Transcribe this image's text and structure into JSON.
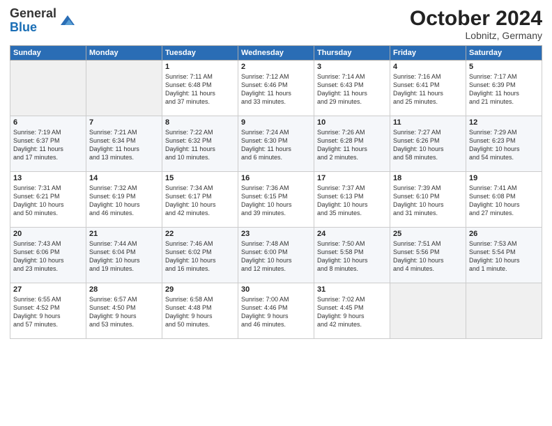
{
  "header": {
    "logo_general": "General",
    "logo_blue": "Blue",
    "month_title": "October 2024",
    "location": "Lobnitz, Germany"
  },
  "weekdays": [
    "Sunday",
    "Monday",
    "Tuesday",
    "Wednesday",
    "Thursday",
    "Friday",
    "Saturday"
  ],
  "weeks": [
    [
      {
        "day": "",
        "content": ""
      },
      {
        "day": "",
        "content": ""
      },
      {
        "day": "1",
        "content": "Sunrise: 7:11 AM\nSunset: 6:48 PM\nDaylight: 11 hours\nand 37 minutes."
      },
      {
        "day": "2",
        "content": "Sunrise: 7:12 AM\nSunset: 6:46 PM\nDaylight: 11 hours\nand 33 minutes."
      },
      {
        "day": "3",
        "content": "Sunrise: 7:14 AM\nSunset: 6:43 PM\nDaylight: 11 hours\nand 29 minutes."
      },
      {
        "day": "4",
        "content": "Sunrise: 7:16 AM\nSunset: 6:41 PM\nDaylight: 11 hours\nand 25 minutes."
      },
      {
        "day": "5",
        "content": "Sunrise: 7:17 AM\nSunset: 6:39 PM\nDaylight: 11 hours\nand 21 minutes."
      }
    ],
    [
      {
        "day": "6",
        "content": "Sunrise: 7:19 AM\nSunset: 6:37 PM\nDaylight: 11 hours\nand 17 minutes."
      },
      {
        "day": "7",
        "content": "Sunrise: 7:21 AM\nSunset: 6:34 PM\nDaylight: 11 hours\nand 13 minutes."
      },
      {
        "day": "8",
        "content": "Sunrise: 7:22 AM\nSunset: 6:32 PM\nDaylight: 11 hours\nand 10 minutes."
      },
      {
        "day": "9",
        "content": "Sunrise: 7:24 AM\nSunset: 6:30 PM\nDaylight: 11 hours\nand 6 minutes."
      },
      {
        "day": "10",
        "content": "Sunrise: 7:26 AM\nSunset: 6:28 PM\nDaylight: 11 hours\nand 2 minutes."
      },
      {
        "day": "11",
        "content": "Sunrise: 7:27 AM\nSunset: 6:26 PM\nDaylight: 10 hours\nand 58 minutes."
      },
      {
        "day": "12",
        "content": "Sunrise: 7:29 AM\nSunset: 6:23 PM\nDaylight: 10 hours\nand 54 minutes."
      }
    ],
    [
      {
        "day": "13",
        "content": "Sunrise: 7:31 AM\nSunset: 6:21 PM\nDaylight: 10 hours\nand 50 minutes."
      },
      {
        "day": "14",
        "content": "Sunrise: 7:32 AM\nSunset: 6:19 PM\nDaylight: 10 hours\nand 46 minutes."
      },
      {
        "day": "15",
        "content": "Sunrise: 7:34 AM\nSunset: 6:17 PM\nDaylight: 10 hours\nand 42 minutes."
      },
      {
        "day": "16",
        "content": "Sunrise: 7:36 AM\nSunset: 6:15 PM\nDaylight: 10 hours\nand 39 minutes."
      },
      {
        "day": "17",
        "content": "Sunrise: 7:37 AM\nSunset: 6:13 PM\nDaylight: 10 hours\nand 35 minutes."
      },
      {
        "day": "18",
        "content": "Sunrise: 7:39 AM\nSunset: 6:10 PM\nDaylight: 10 hours\nand 31 minutes."
      },
      {
        "day": "19",
        "content": "Sunrise: 7:41 AM\nSunset: 6:08 PM\nDaylight: 10 hours\nand 27 minutes."
      }
    ],
    [
      {
        "day": "20",
        "content": "Sunrise: 7:43 AM\nSunset: 6:06 PM\nDaylight: 10 hours\nand 23 minutes."
      },
      {
        "day": "21",
        "content": "Sunrise: 7:44 AM\nSunset: 6:04 PM\nDaylight: 10 hours\nand 19 minutes."
      },
      {
        "day": "22",
        "content": "Sunrise: 7:46 AM\nSunset: 6:02 PM\nDaylight: 10 hours\nand 16 minutes."
      },
      {
        "day": "23",
        "content": "Sunrise: 7:48 AM\nSunset: 6:00 PM\nDaylight: 10 hours\nand 12 minutes."
      },
      {
        "day": "24",
        "content": "Sunrise: 7:50 AM\nSunset: 5:58 PM\nDaylight: 10 hours\nand 8 minutes."
      },
      {
        "day": "25",
        "content": "Sunrise: 7:51 AM\nSunset: 5:56 PM\nDaylight: 10 hours\nand 4 minutes."
      },
      {
        "day": "26",
        "content": "Sunrise: 7:53 AM\nSunset: 5:54 PM\nDaylight: 10 hours\nand 1 minute."
      }
    ],
    [
      {
        "day": "27",
        "content": "Sunrise: 6:55 AM\nSunset: 4:52 PM\nDaylight: 9 hours\nand 57 minutes."
      },
      {
        "day": "28",
        "content": "Sunrise: 6:57 AM\nSunset: 4:50 PM\nDaylight: 9 hours\nand 53 minutes."
      },
      {
        "day": "29",
        "content": "Sunrise: 6:58 AM\nSunset: 4:48 PM\nDaylight: 9 hours\nand 50 minutes."
      },
      {
        "day": "30",
        "content": "Sunrise: 7:00 AM\nSunset: 4:46 PM\nDaylight: 9 hours\nand 46 minutes."
      },
      {
        "day": "31",
        "content": "Sunrise: 7:02 AM\nSunset: 4:45 PM\nDaylight: 9 hours\nand 42 minutes."
      },
      {
        "day": "",
        "content": ""
      },
      {
        "day": "",
        "content": ""
      }
    ]
  ]
}
